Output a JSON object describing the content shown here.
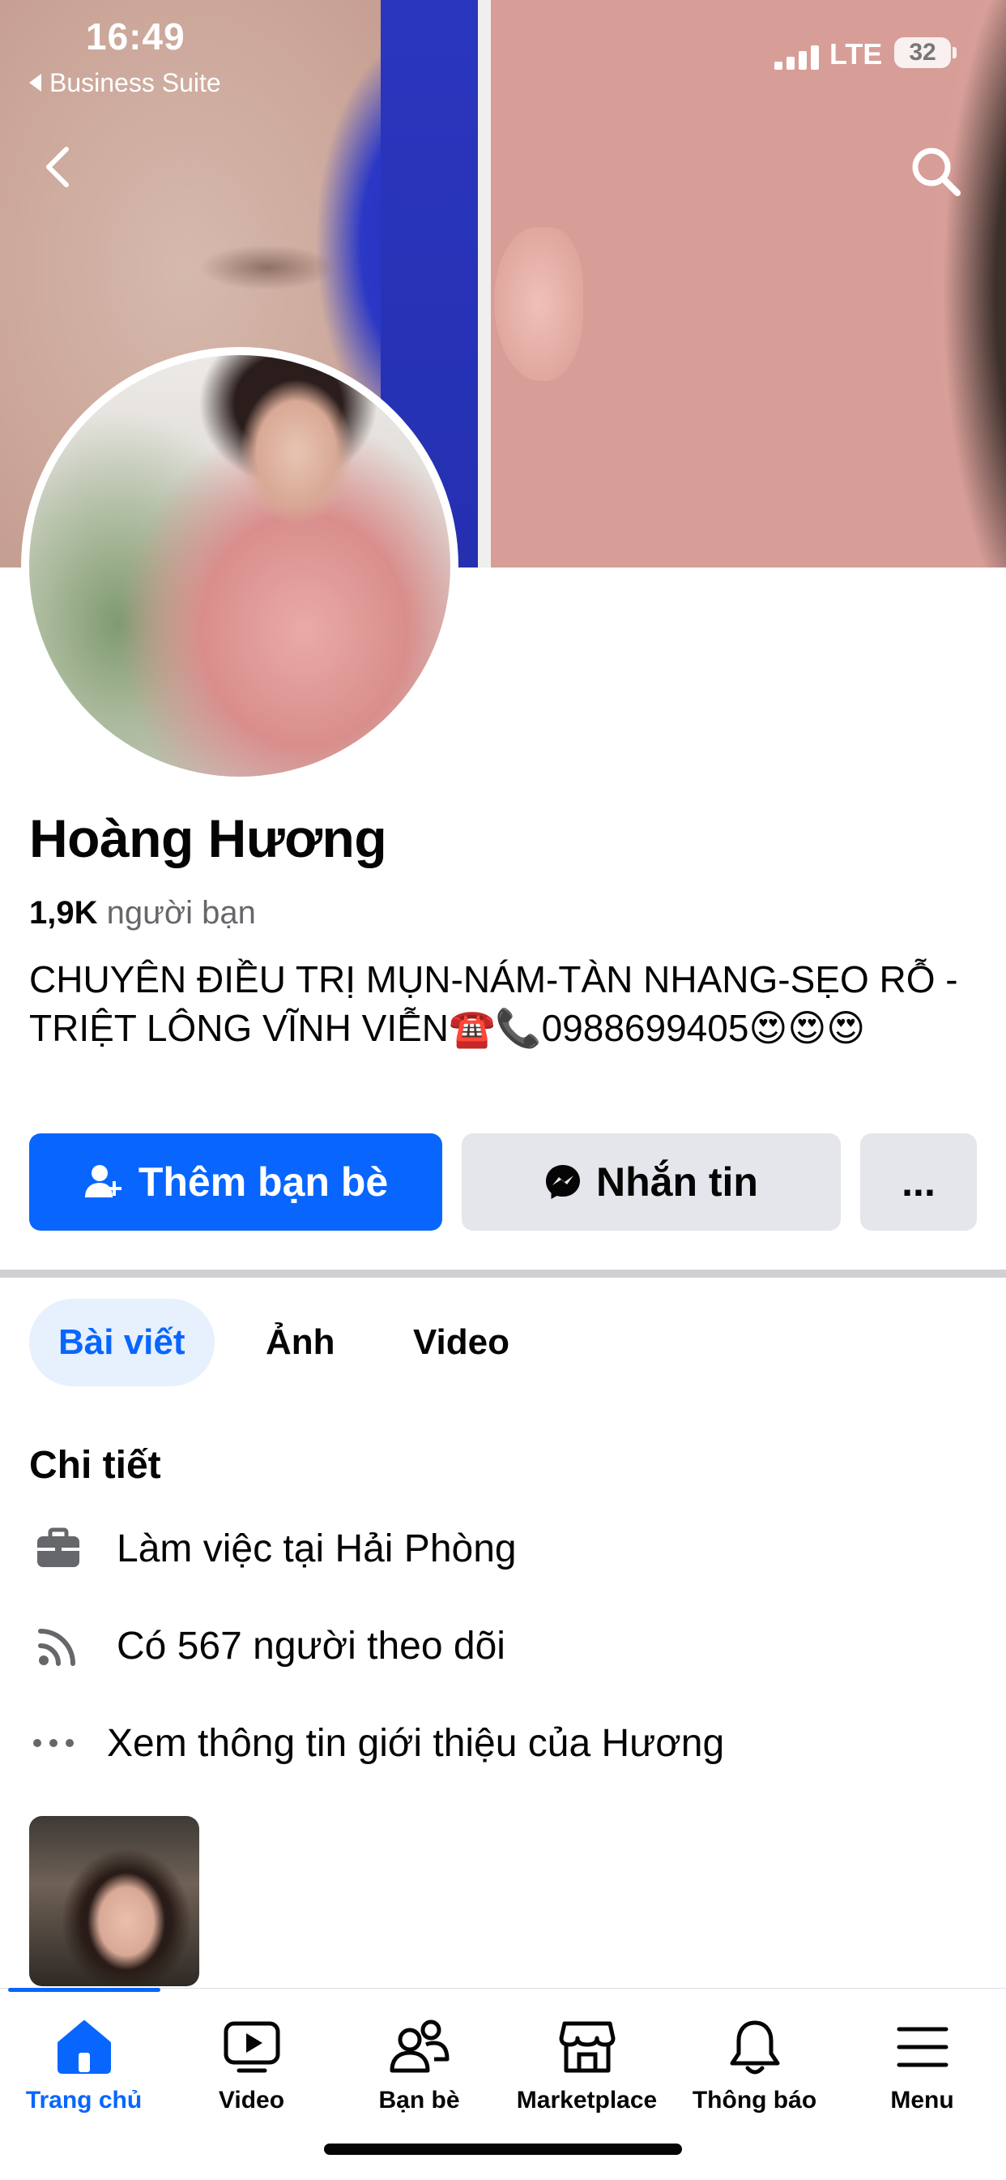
{
  "status_bar": {
    "time": "16:49",
    "back_app": "Business Suite",
    "network": "LTE",
    "battery": "32"
  },
  "header": {
    "back_icon": "chevron-left-icon",
    "search_icon": "search-icon"
  },
  "profile": {
    "name": "Hoàng Hương",
    "friends_count": "1,9K",
    "friends_label": "người bạn",
    "bio": "CHUYÊN ĐIỀU TRỊ MỤN-NÁM-TÀN NHANG-SẸO RỖ -TRIỆT LÔNG VĨNH VIỄN☎️📞0988699405😍😍😍"
  },
  "actions": {
    "add_friend": "Thêm bạn bè",
    "message": "Nhắn tin",
    "more": "..."
  },
  "tabs": [
    {
      "label": "Bài viết",
      "active": true
    },
    {
      "label": "Ảnh",
      "active": false
    },
    {
      "label": "Video",
      "active": false
    }
  ],
  "details": {
    "title": "Chi tiết",
    "items": [
      {
        "icon": "briefcase-icon",
        "text": "Làm việc tại Hải Phòng"
      },
      {
        "icon": "rss-followers-icon",
        "text": "Có 567 người theo dõi"
      },
      {
        "icon": "more-dots-icon",
        "text": "Xem thông tin giới thiệu của Hương"
      }
    ]
  },
  "bottom_nav": [
    {
      "label": "Trang chủ",
      "icon": "home-icon",
      "active": true
    },
    {
      "label": "Video",
      "icon": "video-icon",
      "active": false
    },
    {
      "label": "Bạn bè",
      "icon": "friends-icon",
      "active": false
    },
    {
      "label": "Marketplace",
      "icon": "marketplace-icon",
      "active": false
    },
    {
      "label": "Thông báo",
      "icon": "bell-icon",
      "active": false
    },
    {
      "label": "Menu",
      "icon": "menu-icon",
      "active": false
    }
  ],
  "colors": {
    "accent": "#0866ff",
    "secondary_button": "#e4e6eb",
    "muted_text": "#65676b"
  }
}
